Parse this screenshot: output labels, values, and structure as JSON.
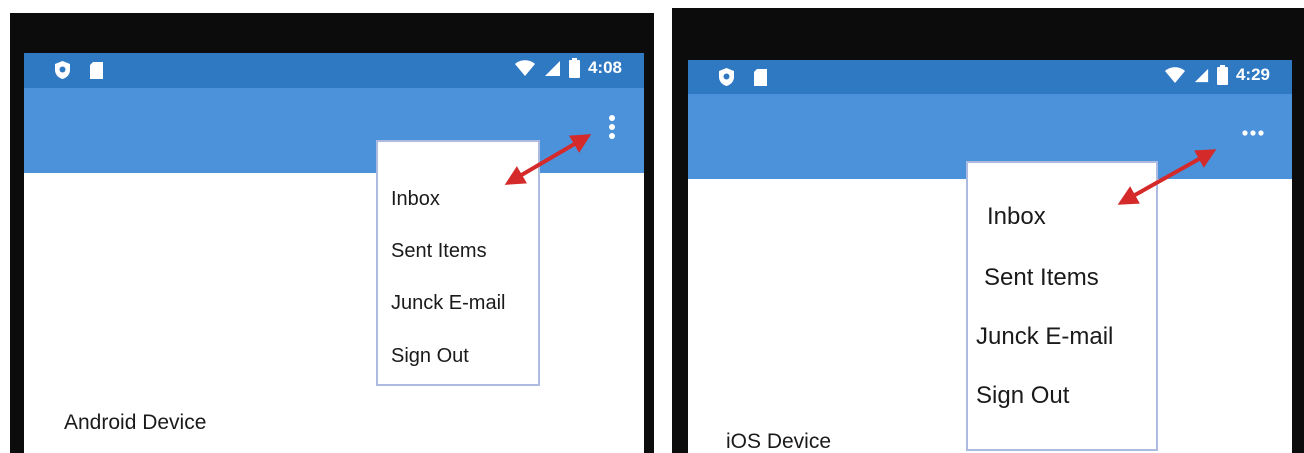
{
  "android": {
    "status_bar": {
      "time": "4:08",
      "icons": [
        "shield-icon",
        "sd-card-icon",
        "wifi-icon",
        "signal-icon",
        "battery-icon"
      ]
    },
    "app_bar": {
      "overflow_icon": "vertical-dots-icon"
    },
    "menu": {
      "items": [
        {
          "label": "Inbox"
        },
        {
          "label": "Sent Items"
        },
        {
          "label": "Junck E-mail"
        },
        {
          "label": "Sign Out"
        }
      ]
    },
    "device_label": "Android Device"
  },
  "ios": {
    "status_bar": {
      "time": "4:29",
      "icons": [
        "shield-icon",
        "sd-card-icon",
        "wifi-icon",
        "signal-icon",
        "battery-icon"
      ]
    },
    "app_bar": {
      "overflow_icon": "horizontal-dots-icon"
    },
    "menu": {
      "items": [
        {
          "label": "Inbox"
        },
        {
          "label": "Sent Items"
        },
        {
          "label": "Junck E-mail"
        },
        {
          "label": "Sign Out"
        }
      ]
    },
    "device_label": "iOS Device"
  },
  "colors": {
    "status_bar": "#2f78c2",
    "app_bar": "#4c92db",
    "menu_border": "#aebbe0",
    "arrow": "#d42a2a",
    "device_frame": "#0c0c0c"
  }
}
